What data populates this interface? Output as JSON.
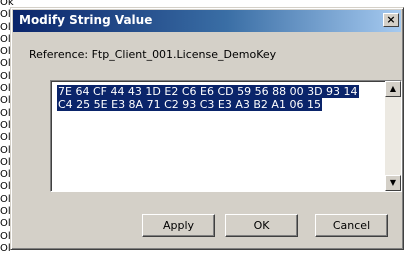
{
  "background": {
    "lines": [
      "Ok",
      "Ol",
      "Ol",
      "Ol",
      "Ol",
      "Ol",
      "Ol",
      "Ol",
      "Ol",
      "Ol",
      "Ol",
      "Ol",
      "Ol",
      "Ol",
      "Ol",
      "Ol",
      "Ol",
      "Ol",
      "Ol",
      "Ol",
      "Ol"
    ]
  },
  "dialog": {
    "title": "Modify String Value",
    "close_glyph": "×",
    "reference_label": "Reference: Ftp_Client_001.License_DemoKey",
    "value_lines": [
      "7E 64 CF 44 43 1D E2 C6 E6 CD 59 56 88 00 3D 93 14",
      "C4 25 5E E3 8A 71 C2 93 C3 E3 A3 B2 A1 06 15"
    ],
    "buttons": {
      "apply": "Apply",
      "ok": "OK",
      "cancel": "Cancel"
    }
  }
}
